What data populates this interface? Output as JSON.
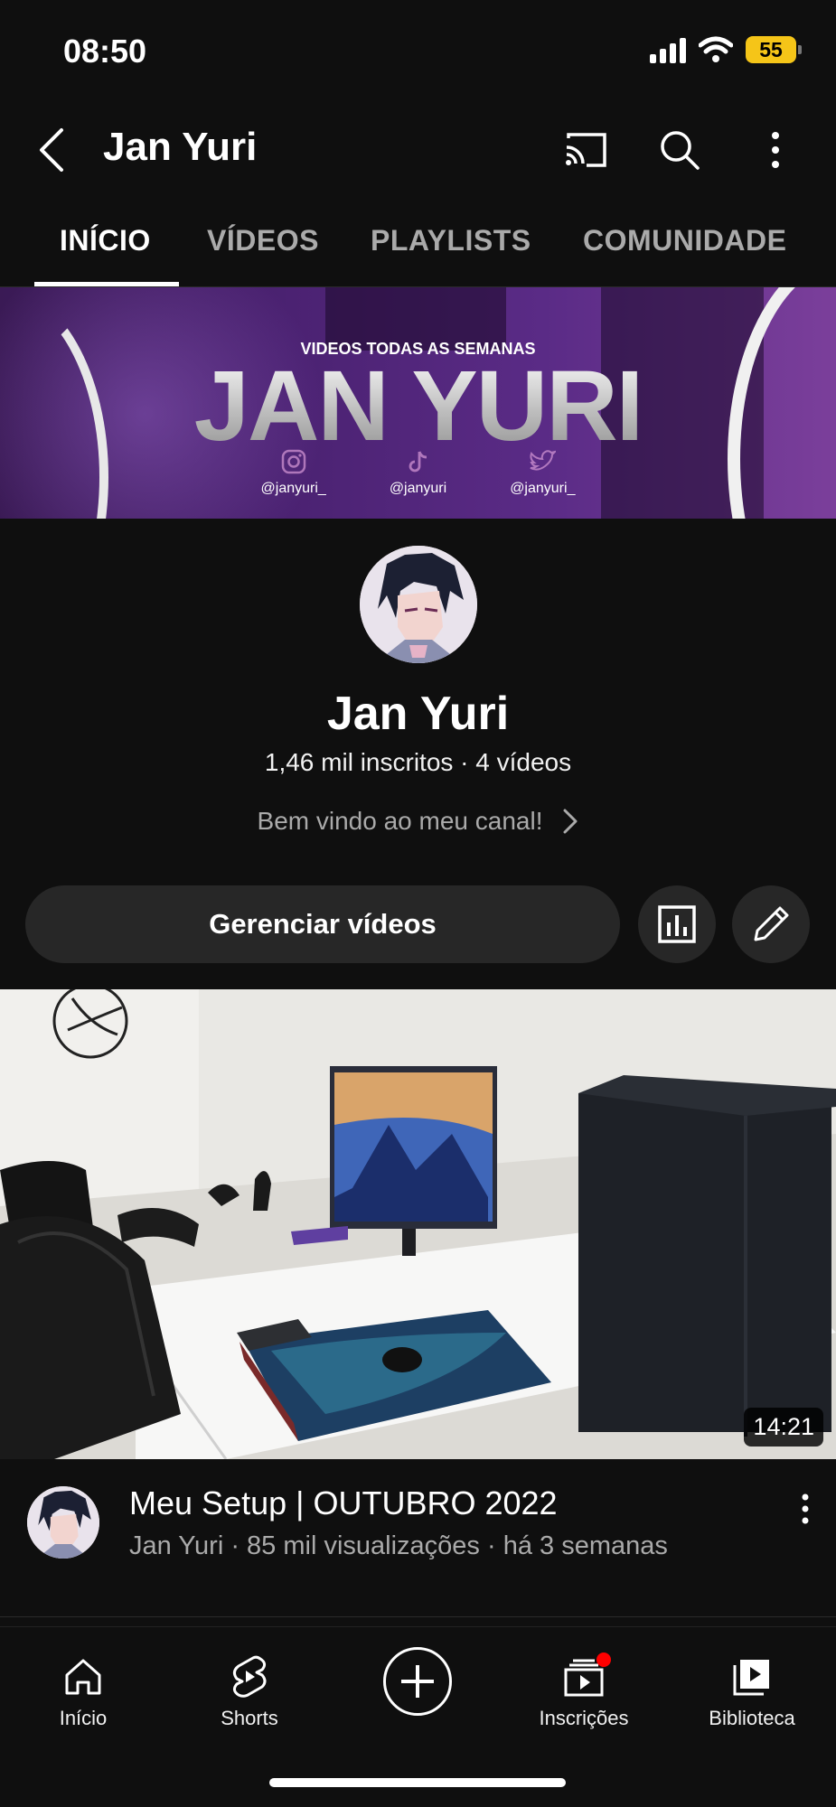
{
  "status_bar": {
    "time": "08:50",
    "battery": "55"
  },
  "header": {
    "title": "Jan Yuri"
  },
  "tabs": [
    {
      "label": "INÍCIO",
      "active": true
    },
    {
      "label": "VÍDEOS",
      "active": false
    },
    {
      "label": "PLAYLISTS",
      "active": false
    },
    {
      "label": "COMUNIDADE",
      "active": false
    }
  ],
  "banner": {
    "subtitle": "VIDEOS TODAS AS SEMANAS",
    "title": "JAN YURI",
    "socials": [
      {
        "icon": "instagram-icon",
        "handle": "@janyuri_"
      },
      {
        "icon": "tiktok-icon",
        "handle": "@janyuri"
      },
      {
        "icon": "twitter-icon",
        "handle": "@janyuri_"
      }
    ]
  },
  "channel": {
    "name": "Jan Yuri",
    "stats": "1,46 mil inscritos · 4 vídeos",
    "description": "Bem vindo ao meu canal!"
  },
  "actions": {
    "manage_label": "Gerenciar vídeos"
  },
  "video": {
    "duration": "14:21",
    "title": "Meu Setup | OUTUBRO 2022",
    "meta": "Jan Yuri · 85 mil visualizações · há 3 semanas"
  },
  "bottom_nav": [
    {
      "label": "Início",
      "icon": "home-icon"
    },
    {
      "label": "Shorts",
      "icon": "shorts-icon"
    },
    {
      "label": "",
      "icon": "create-icon"
    },
    {
      "label": "Inscrições",
      "icon": "subscriptions-icon"
    },
    {
      "label": "Biblioteca",
      "icon": "library-icon"
    }
  ],
  "colors": {
    "background": "#0f0f0f",
    "surface": "#272727",
    "secondary_text": "#aaaaaa",
    "battery": "#f5c518",
    "notification": "#ff0000"
  }
}
